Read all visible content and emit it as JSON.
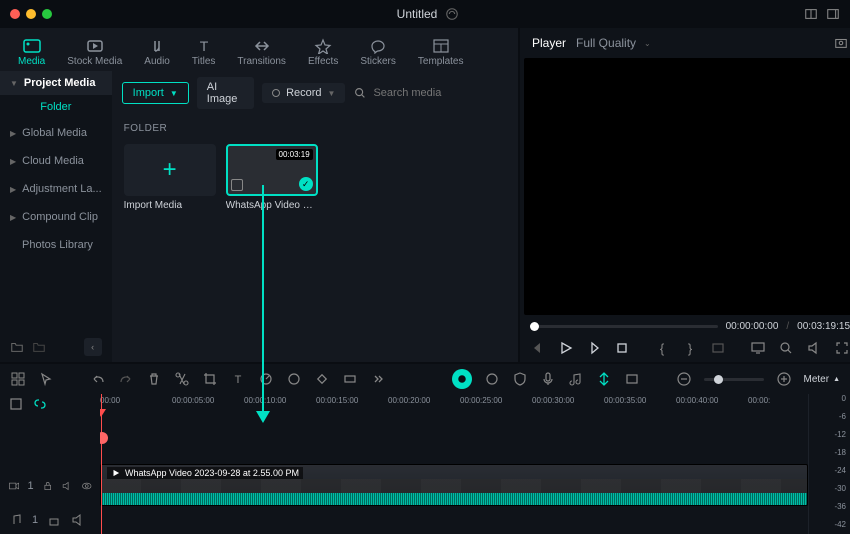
{
  "titlebar": {
    "title": "Untitled"
  },
  "nav": {
    "media": "Media",
    "stock": "Stock Media",
    "audio": "Audio",
    "titles": "Titles",
    "transitions": "Transitions",
    "effects": "Effects",
    "stickers": "Stickers",
    "templates": "Templates"
  },
  "subbar": {
    "import": "Import",
    "aiimage": "AI Image",
    "record": "Record",
    "search_placeholder": "Search media"
  },
  "sidebar": {
    "project_media": "Project Media",
    "folder": "Folder",
    "items": [
      "Global Media",
      "Cloud Media",
      "Adjustment La...",
      "Compound Clip",
      "Photos Library"
    ]
  },
  "filearea": {
    "folder_label": "FOLDER",
    "import_media": "Import Media",
    "clip_name": "WhatsApp Video 202...",
    "clip_duration": "00:03:19"
  },
  "player": {
    "label": "Player",
    "quality": "Full Quality",
    "cur_time": "00:00:00:00",
    "sep": "/",
    "total_time": "00:03:19:15"
  },
  "timeline": {
    "ruler": [
      "00:00",
      "00:00:05:00",
      "00:00:10:00",
      "00:00:15:00",
      "00:00:20:00",
      "00:00:25:00",
      "00:00:30:00",
      "00:00:35:00",
      "00:00:40:00",
      "00:00:"
    ],
    "clip_title": "WhatsApp Video 2023-09-28 at 2.55.00 PM",
    "track_v": "1",
    "track_a": "1",
    "meter_label": "Meter",
    "levels": [
      "0",
      "-6",
      "-12",
      "-18",
      "-24",
      "-30",
      "-36",
      "-42"
    ]
  }
}
